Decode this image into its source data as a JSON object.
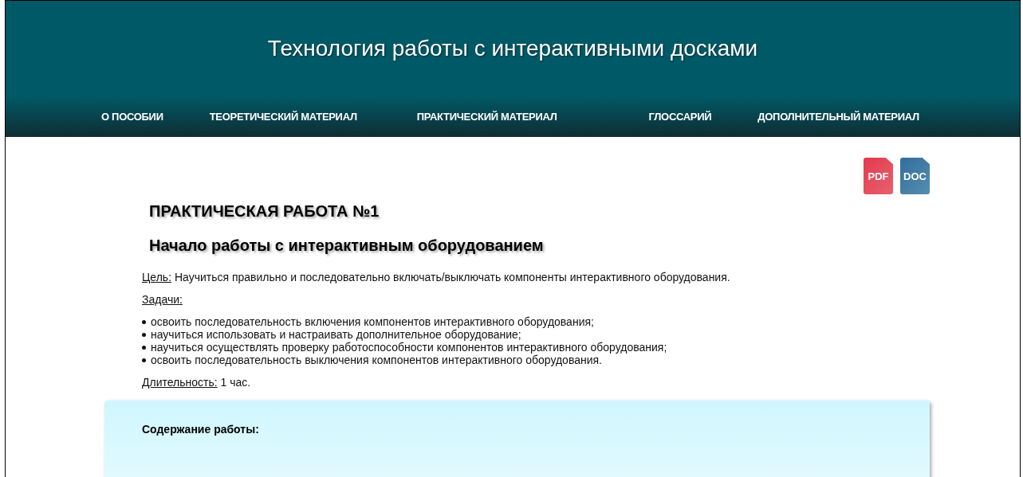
{
  "header": {
    "title": "Технология работы с интерактивными досками"
  },
  "nav": [
    {
      "label": "О ПОСОБИИ"
    },
    {
      "label": "ТЕОРЕТИЧЕСКИЙ МАТЕРИАЛ"
    },
    {
      "label": "ПРАКТИЧЕСКИЙ МАТЕРИАЛ"
    },
    {
      "label": "ГЛОССАРИЙ"
    },
    {
      "label": "ДОПОЛНИТЕЛЬНЫЙ МАТЕРИАЛ"
    }
  ],
  "downloads": [
    {
      "label": "PDF",
      "color": "#e23a4c"
    },
    {
      "label": "DOC",
      "color": "#2f6f9c"
    }
  ],
  "heading": "ПРАКТИЧЕСКАЯ РАБОТА №1",
  "subheading": "Начало работы с интерактивным оборудованием",
  "goal": {
    "label": "Цель:",
    "text": "Научиться правильно и последовательно включать/выключать компоненты интерактивного оборудования."
  },
  "tasks": {
    "label": "Задачи:",
    "items": [
      "освоить последовательность включения компонентов интерактивного оборудования;",
      "научиться использовать и настраивать дополнительное оборудование;",
      "научиться осуществлять проверку работоспособности компонентов интерактивного оборудования;",
      "освоить последовательность выключения компонентов интерактивного оборудования."
    ]
  },
  "duration": {
    "label": "Длительность:",
    "text": "1 час."
  },
  "content_box": {
    "title": "Содержание работы:"
  }
}
